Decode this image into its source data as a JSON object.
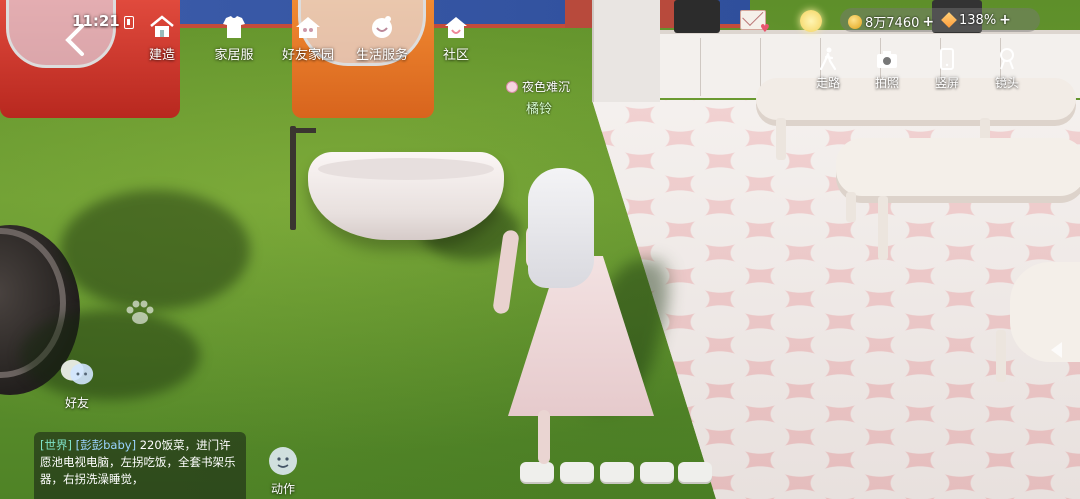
{
  "status": {
    "time": "11:21",
    "battery": "8"
  },
  "nav": {
    "items": [
      {
        "label": "建造",
        "icon": "build-house-icon"
      },
      {
        "label": "家居服",
        "icon": "homewear-shirt-icon"
      },
      {
        "label": "好友家园",
        "icon": "friend-home-icon"
      },
      {
        "label": "生活服务",
        "icon": "life-service-icon"
      },
      {
        "label": "社区",
        "icon": "community-house-icon"
      }
    ]
  },
  "resources": {
    "coins": "8万7460",
    "gems": "138%"
  },
  "tools": [
    {
      "label": "走路",
      "icon": "walk-icon"
    },
    {
      "label": "拍照",
      "icon": "camera-icon"
    },
    {
      "label": "竖屏",
      "icon": "portrait-screen-icon"
    },
    {
      "label": "镜头",
      "icon": "camera-lens-icon"
    }
  ],
  "player": {
    "title": "夜色难沉",
    "name": "橘铃"
  },
  "side": {
    "friends_label": "好友",
    "action_label": "动作"
  },
  "chat": {
    "channel": "[世界]",
    "user": "[彭彭baby]",
    "message": "220饭菜，进门许愿池电视电脑，左拐吃饭，全套书架乐器，右拐洗澡睡觉，"
  },
  "colors": {
    "grass": "#6a9b33",
    "patio": "#f1c9c9",
    "chat_channel": "#7fe2c8",
    "chat_user": "#9ad4ff"
  }
}
